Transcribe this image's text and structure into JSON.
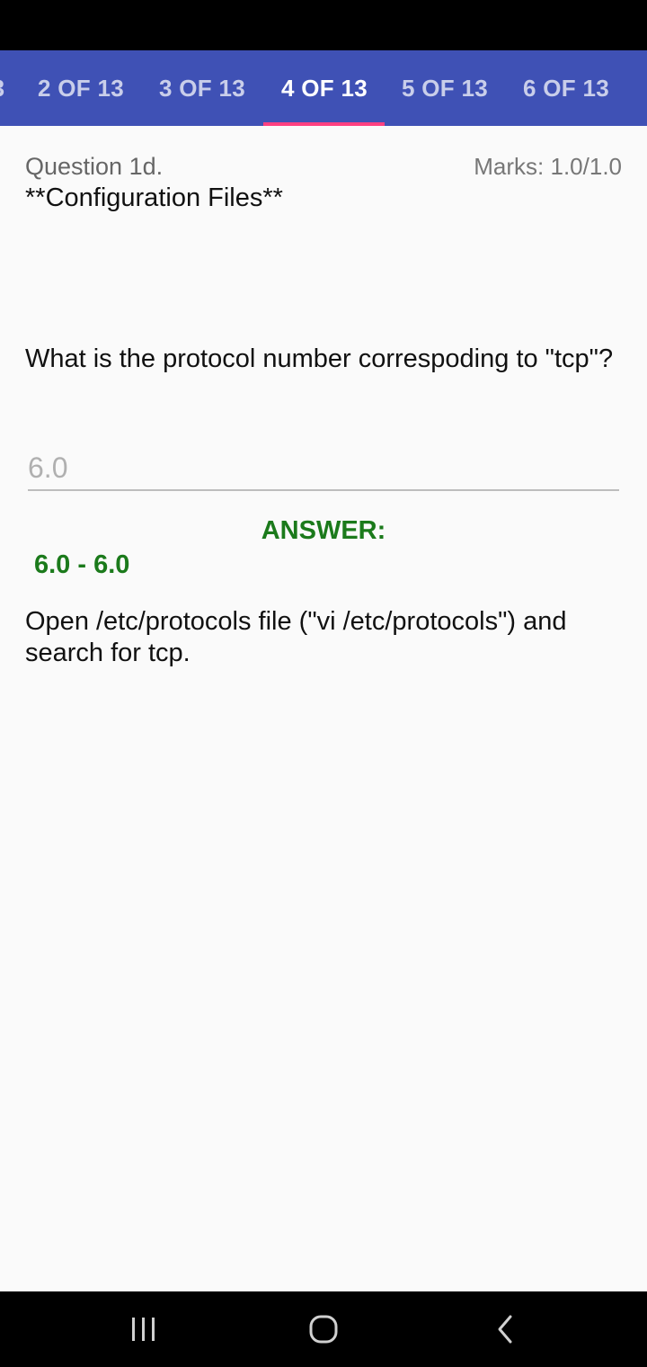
{
  "tabs": [
    {
      "label": "2 OF 13",
      "active": false
    },
    {
      "label": "3 OF 13",
      "active": false
    },
    {
      "label": "4 OF 13",
      "active": true
    },
    {
      "label": "5 OF 13",
      "active": false
    },
    {
      "label": "6 OF 13",
      "active": false
    }
  ],
  "question": {
    "number": "Question 1d.",
    "marks": "Marks: 1.0/1.0",
    "title": "**Configuration Files**",
    "text": "What is the protocol number correspoding to \"tcp\"?",
    "input_placeholder": "6.0"
  },
  "answer": {
    "label": "ANSWER:",
    "range": "6.0 - 6.0",
    "explanation": "Open /etc/protocols file (\"vi /etc/protocols\") and search for tcp."
  },
  "nav": {
    "icons": [
      "recent-apps-icon",
      "home-icon",
      "back-icon"
    ]
  },
  "colors": {
    "tab_bar": "#3f51b5",
    "tab_indicator": "#ff4081",
    "answer_green": "#1b7a1b",
    "background": "#fafafa"
  }
}
